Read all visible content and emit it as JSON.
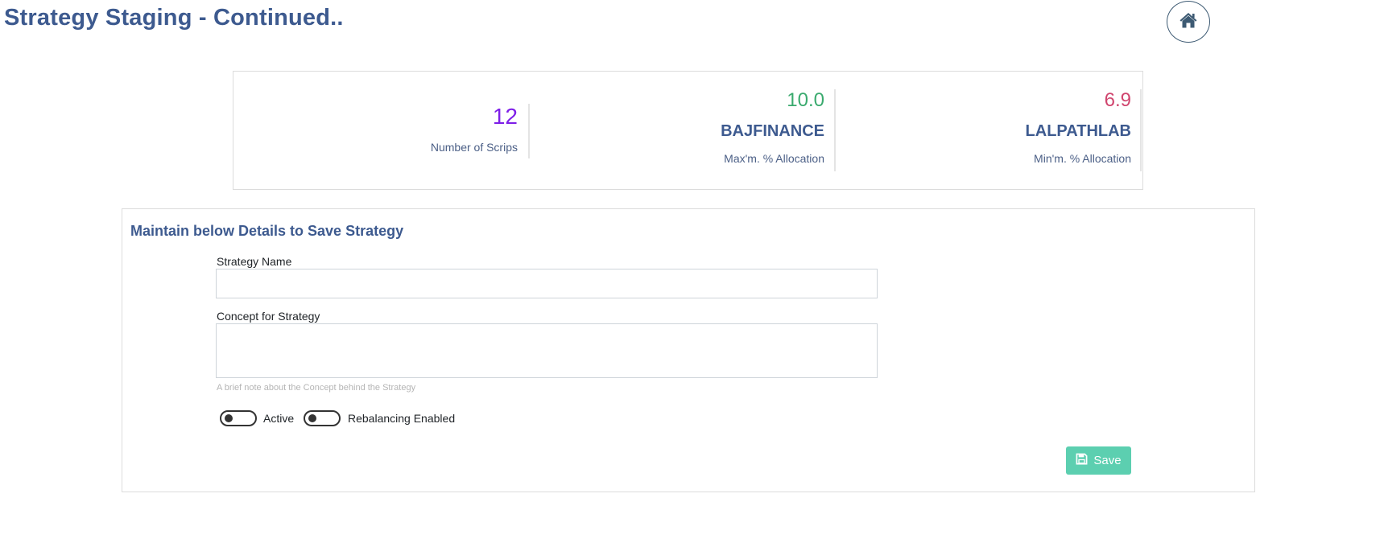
{
  "page": {
    "title": "Strategy Staging - Continued.."
  },
  "header": {
    "home_icon": "home-icon"
  },
  "stats": {
    "scrips_count": "12",
    "scrips_label": "Number of Scrips",
    "max_value": "10.0",
    "max_symbol": "BAJFINANCE",
    "max_label": "Max'm. % Allocation",
    "min_value": "6.9",
    "min_symbol": "LALPATHLAB",
    "min_label": "Min'm. % Allocation"
  },
  "form": {
    "heading": "Maintain below Details to Save Strategy",
    "strategy_name_label": "Strategy Name",
    "strategy_name_value": "",
    "concept_label": "Concept for Strategy",
    "concept_value": "",
    "concept_help": "A brief note about the Concept behind the Strategy",
    "active_label": "Active",
    "active_on": false,
    "rebalancing_label": "Rebalancing Enabled",
    "rebalancing_on": false,
    "save_label": "Save",
    "save_icon": "floppy-disk-icon"
  },
  "colors": {
    "title": "#3d5a8f",
    "scrips": "#7e1fe8",
    "max": "#3aaa6e",
    "min": "#d0456e",
    "save_button": "#5ccfb0"
  }
}
